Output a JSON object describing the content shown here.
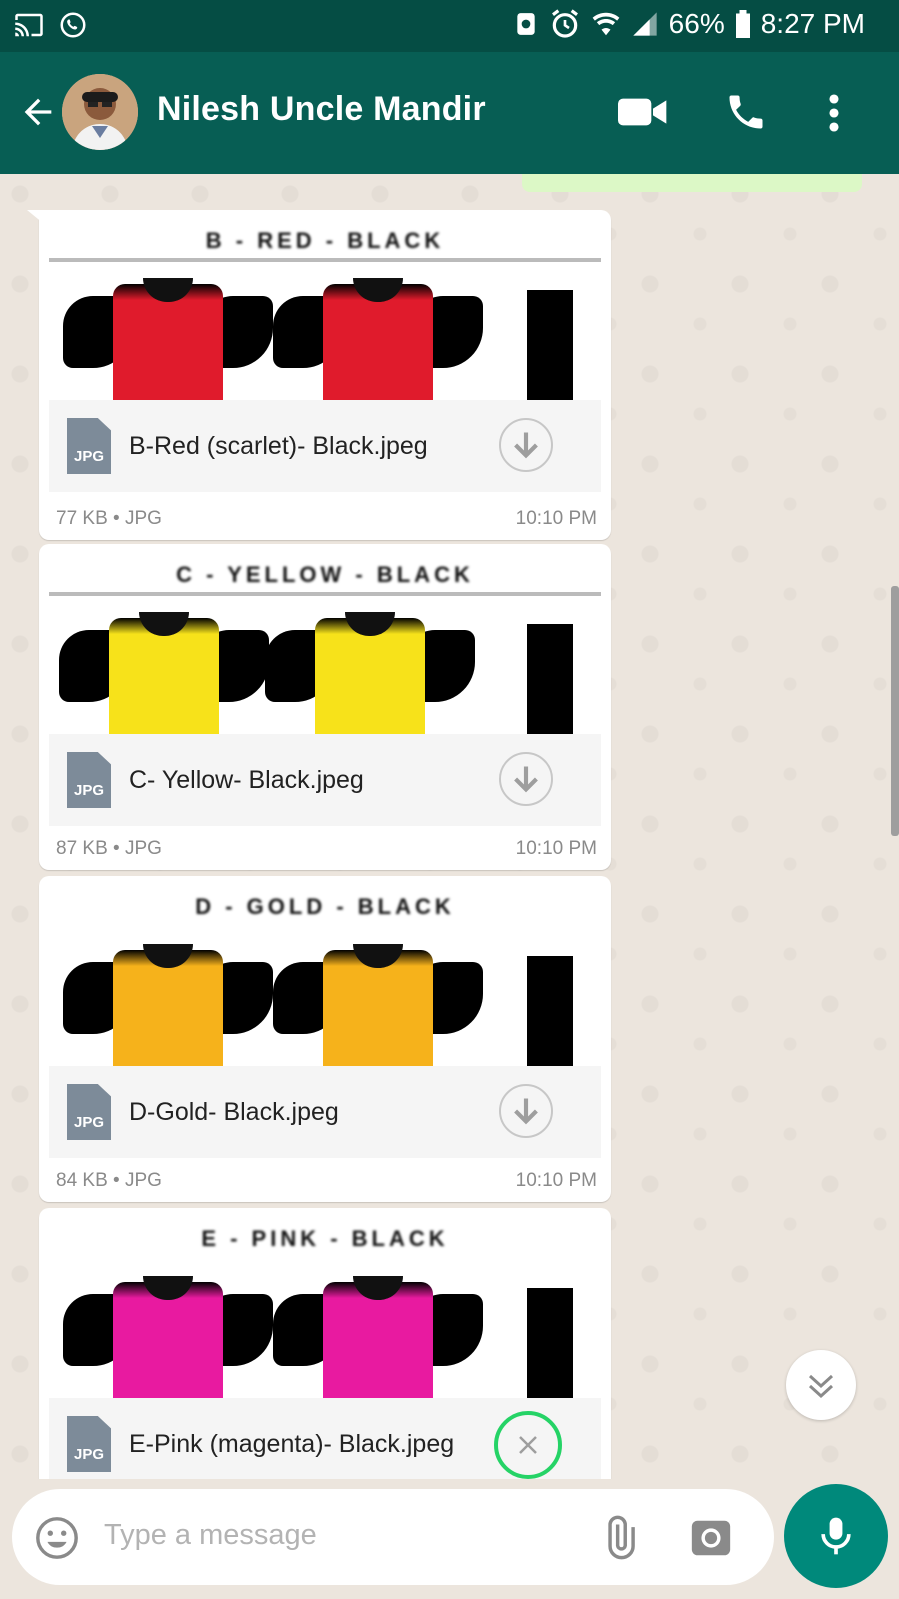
{
  "status_bar": {
    "battery": "66%",
    "time": "8:27 PM",
    "icons": [
      "cast-icon",
      "whatsapp-icon",
      "data-saver-icon",
      "alarm-icon",
      "wifi-icon",
      "signal-icon",
      "battery-icon"
    ]
  },
  "header": {
    "contact_name": "Nilesh Uncle Mandir",
    "actions": [
      "video-call-icon",
      "phone-icon",
      "more-options-icon"
    ]
  },
  "messages": [
    {
      "filename": "B-Red (scarlet)- Black.jpeg",
      "size": "77 KB",
      "type": "JPG",
      "time": "10:10 PM",
      "icon_label": "JPG",
      "color": "#e01b2c",
      "state": "download"
    },
    {
      "filename": "C- Yellow- Black.jpeg",
      "size": "87 KB",
      "type": "JPG",
      "time": "10:10 PM",
      "icon_label": "JPG",
      "color": "#f7e21a",
      "state": "download"
    },
    {
      "filename": "D-Gold- Black.jpeg",
      "size": "84 KB",
      "type": "JPG",
      "time": "10:10 PM",
      "icon_label": "JPG",
      "color": "#f6b21b",
      "state": "download"
    },
    {
      "filename": "E-Pink (magenta)- Black.jpeg",
      "size": "",
      "type": "JPG",
      "time": "",
      "icon_label": "JPG",
      "color": "#e81aa0",
      "state": "downloading"
    }
  ],
  "meta_separator": "•",
  "composer": {
    "placeholder": "Type a message"
  },
  "colors": {
    "status_bar": "#054d44",
    "app_bar": "#075e54",
    "chat_bg": "#ece5dd",
    "mic_button": "#00897b",
    "progress_ring": "#25d366"
  }
}
